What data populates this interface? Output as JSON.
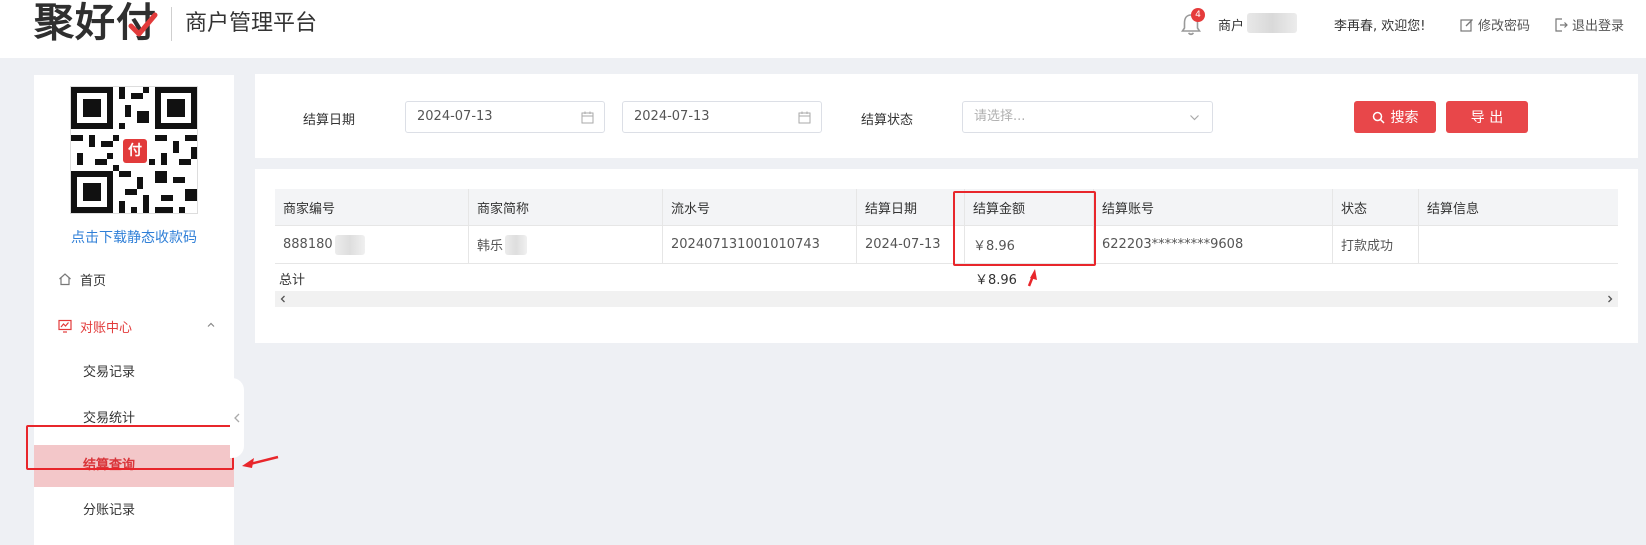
{
  "header": {
    "logo_text": "聚好付",
    "platform_title": "商户管理平台",
    "notification_count": "4",
    "merchant_label": "商户",
    "welcome_text": "李再春, 欢迎您!",
    "change_password": "修改密码",
    "logout": "退出登录"
  },
  "sidebar": {
    "download_link": "点击下载静态收款码",
    "qr_center": "付",
    "items": [
      {
        "label": "首页",
        "icon": "home-icon"
      },
      {
        "label": "对账中心",
        "icon": "reconciliation-icon",
        "expanded": true
      }
    ],
    "sub_items": [
      {
        "label": "交易记录"
      },
      {
        "label": "交易统计"
      },
      {
        "label": "结算查询",
        "active": true
      },
      {
        "label": "分账记录"
      }
    ]
  },
  "filter": {
    "date_label": "结算日期",
    "start_date": "2024-07-13",
    "end_date": "2024-07-13",
    "status_label": "结算状态",
    "status_placeholder": "请选择...",
    "search_button": "搜索",
    "export_button": "导 出"
  },
  "table": {
    "columns": [
      "商家编号",
      "商家简称",
      "流水号",
      "结算日期",
      "结算金额",
      "结算账号",
      "状态",
      "结算信息"
    ],
    "rows": [
      {
        "merchant_no": "888180",
        "merchant_name": "韩乐",
        "serial_no": "202407131001010743",
        "settle_date": "2024-07-13",
        "amount": "￥8.96",
        "account": "622203*********9608",
        "status": "打款成功",
        "info": ""
      }
    ],
    "total_label": "总计",
    "total_amount": "￥8.96"
  },
  "colors": {
    "accent": "#e8474a",
    "highlight_red": "#e8262b",
    "link_blue": "#2f7fd7",
    "active_bg": "#f3c7c9"
  }
}
